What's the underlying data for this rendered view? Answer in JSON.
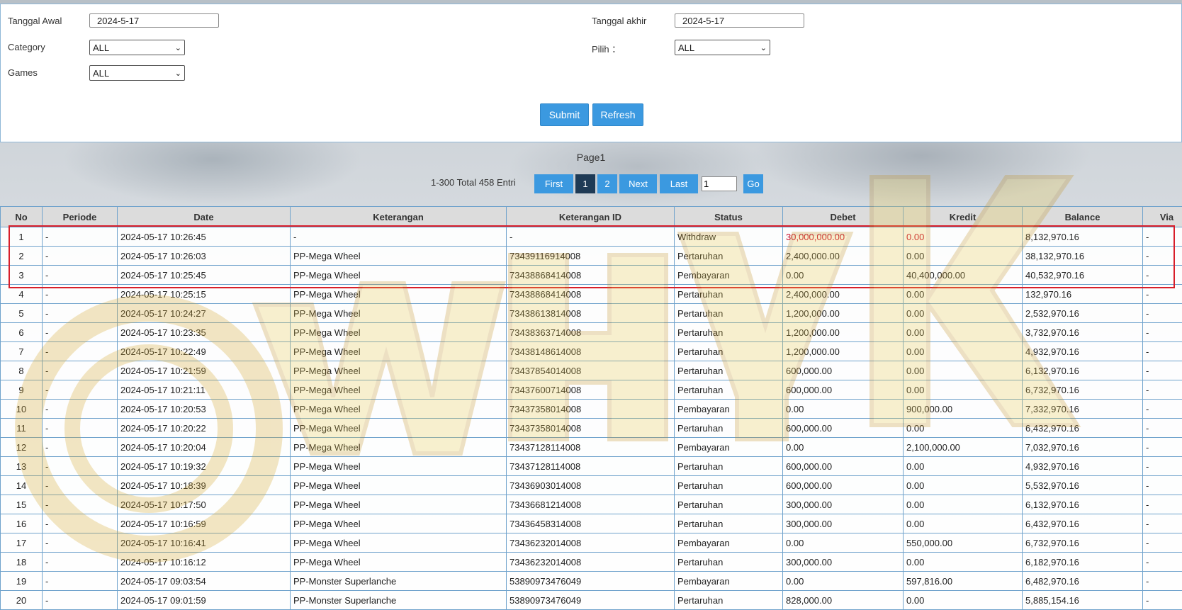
{
  "filters": {
    "start_label": "Tanggal Awal",
    "start_value": "2024-5-17",
    "end_label": "Tanggal akhir",
    "end_value": "2024-5-17",
    "category_label": "Category",
    "category_value": "ALL",
    "pilih_label": "Pilih ：",
    "pilih_value": "ALL",
    "games_label": "Games",
    "games_value": "ALL",
    "submit_label": "Submit",
    "refresh_label": "Refresh"
  },
  "pagination": {
    "title": "Page1",
    "entries": "1-300 Total 458 Entri",
    "first": "First",
    "p1": "1",
    "p2": "2",
    "next": "Next",
    "last": "Last",
    "input_value": "1",
    "go": "Go"
  },
  "table": {
    "headers": [
      "No",
      "Periode",
      "Date",
      "Keterangan",
      "Keterangan ID",
      "Status",
      "Debet",
      "Kredit",
      "Balance",
      "Via"
    ],
    "rows": [
      [
        "1",
        "-",
        "2024-05-17 10:26:45",
        "-",
        "-",
        "Withdraw",
        "30,000,000.00",
        "0.00",
        "8,132,970.16",
        "-"
      ],
      [
        "2",
        "-",
        "2024-05-17 10:26:03",
        "PP-Mega Wheel",
        "73439116914008",
        "Pertaruhan",
        "2,400,000.00",
        "0.00",
        "38,132,970.16",
        "-"
      ],
      [
        "3",
        "-",
        "2024-05-17 10:25:45",
        "PP-Mega Wheel",
        "73438868414008",
        "Pembayaran",
        "0.00",
        "40,400,000.00",
        "40,532,970.16",
        "-"
      ],
      [
        "4",
        "-",
        "2024-05-17 10:25:15",
        "PP-Mega Wheel",
        "73438868414008",
        "Pertaruhan",
        "2,400,000.00",
        "0.00",
        "132,970.16",
        "-"
      ],
      [
        "5",
        "-",
        "2024-05-17 10:24:27",
        "PP-Mega Wheel",
        "73438613814008",
        "Pertaruhan",
        "1,200,000.00",
        "0.00",
        "2,532,970.16",
        "-"
      ],
      [
        "6",
        "-",
        "2024-05-17 10:23:35",
        "PP-Mega Wheel",
        "73438363714008",
        "Pertaruhan",
        "1,200,000.00",
        "0.00",
        "3,732,970.16",
        "-"
      ],
      [
        "7",
        "-",
        "2024-05-17 10:22:49",
        "PP-Mega Wheel",
        "73438148614008",
        "Pertaruhan",
        "1,200,000.00",
        "0.00",
        "4,932,970.16",
        "-"
      ],
      [
        "8",
        "-",
        "2024-05-17 10:21:59",
        "PP-Mega Wheel",
        "73437854014008",
        "Pertaruhan",
        "600,000.00",
        "0.00",
        "6,132,970.16",
        "-"
      ],
      [
        "9",
        "-",
        "2024-05-17 10:21:11",
        "PP-Mega Wheel",
        "73437600714008",
        "Pertaruhan",
        "600,000.00",
        "0.00",
        "6,732,970.16",
        "-"
      ],
      [
        "10",
        "-",
        "2024-05-17 10:20:53",
        "PP-Mega Wheel",
        "73437358014008",
        "Pembayaran",
        "0.00",
        "900,000.00",
        "7,332,970.16",
        "-"
      ],
      [
        "11",
        "-",
        "2024-05-17 10:20:22",
        "PP-Mega Wheel",
        "73437358014008",
        "Pertaruhan",
        "600,000.00",
        "0.00",
        "6,432,970.16",
        "-"
      ],
      [
        "12",
        "-",
        "2024-05-17 10:20:04",
        "PP-Mega Wheel",
        "73437128114008",
        "Pembayaran",
        "0.00",
        "2,100,000.00",
        "7,032,970.16",
        "-"
      ],
      [
        "13",
        "-",
        "2024-05-17 10:19:32",
        "PP-Mega Wheel",
        "73437128114008",
        "Pertaruhan",
        "600,000.00",
        "0.00",
        "4,932,970.16",
        "-"
      ],
      [
        "14",
        "-",
        "2024-05-17 10:18:39",
        "PP-Mega Wheel",
        "73436903014008",
        "Pertaruhan",
        "600,000.00",
        "0.00",
        "5,532,970.16",
        "-"
      ],
      [
        "15",
        "-",
        "2024-05-17 10:17:50",
        "PP-Mega Wheel",
        "73436681214008",
        "Pertaruhan",
        "300,000.00",
        "0.00",
        "6,132,970.16",
        "-"
      ],
      [
        "16",
        "-",
        "2024-05-17 10:16:59",
        "PP-Mega Wheel",
        "73436458314008",
        "Pertaruhan",
        "300,000.00",
        "0.00",
        "6,432,970.16",
        "-"
      ],
      [
        "17",
        "-",
        "2024-05-17 10:16:41",
        "PP-Mega Wheel",
        "73436232014008",
        "Pembayaran",
        "0.00",
        "550,000.00",
        "6,732,970.16",
        "-"
      ],
      [
        "18",
        "-",
        "2024-05-17 10:16:12",
        "PP-Mega Wheel",
        "73436232014008",
        "Pertaruhan",
        "300,000.00",
        "0.00",
        "6,182,970.16",
        "-"
      ],
      [
        "19",
        "-",
        "2024-05-17 09:03:54",
        "PP-Monster Superlanche",
        "53890973476049",
        "Pembayaran",
        "0.00",
        "597,816.00",
        "6,482,970.16",
        "-"
      ],
      [
        "20",
        "-",
        "2024-05-17 09:01:59",
        "PP-Monster Superlanche",
        "53890973476049",
        "Pertaruhan",
        "828,000.00",
        "0.00",
        "5,885,154.16",
        "-"
      ]
    ]
  },
  "colors": {
    "accent": "#3b99e0",
    "active_page": "#1e3a55",
    "withdraw_red": "#c8102e",
    "highlight": "#d81e2a",
    "watermark": "#e9c94a"
  }
}
